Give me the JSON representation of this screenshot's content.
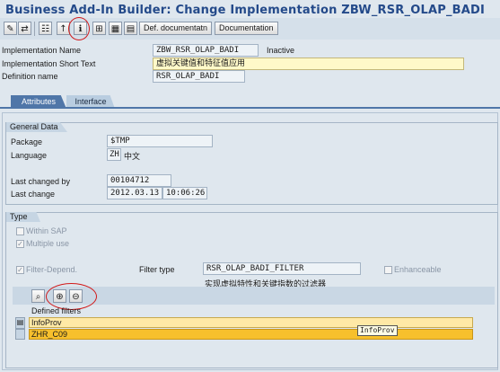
{
  "window": {
    "title": "Business Add-In Builder: Change Implementation ZBW_RSR_OLAP_BADI"
  },
  "toolbar": {
    "icons": [
      "pencil-glasses-icon",
      "where-used-icon",
      "object-list-icon",
      "activate-icon",
      "info-icon",
      "hierarchy-icon",
      "object-directory-icon",
      "documentation-icon"
    ],
    "def_documentation_label": "Def. documentatn",
    "documentation_label": "Documentation"
  },
  "header": {
    "impl_name_label": "Implementation Name",
    "impl_name_value": "ZBW_RSR_OLAP_BADI",
    "impl_status": "Inactive",
    "short_text_label": "Implementation Short Text",
    "short_text_value": "虚拟关键值和特征值应用",
    "def_name_label": "Definition name",
    "def_name_value": "RSR_OLAP_BADI"
  },
  "tabs": [
    {
      "label": "Attributes",
      "active": true
    },
    {
      "label": "Interface",
      "active": false
    }
  ],
  "general_data": {
    "title": "General Data",
    "package_label": "Package",
    "package_value": "$TMP",
    "language_label": "Language",
    "language_code": "ZH",
    "language_name": "中文",
    "last_changed_by_label": "Last changed by",
    "last_changed_by_value": "00104712",
    "last_change_label": "Last change",
    "last_change_date": "2012.03.13",
    "last_change_time": "10:06:26"
  },
  "type_group": {
    "title": "Type",
    "within_sap_label": "Within SAP",
    "within_sap_checked": false,
    "multiple_use_label": "Multiple use",
    "multiple_use_checked": true,
    "filter_depend_label": "Filter-Depend.",
    "filter_depend_checked": true,
    "filter_type_label": "Filter type",
    "filter_type_value": "RSR_OLAP_BADI_FILTER",
    "filter_type_desc": "实现虚拟特性和关键指数的过滤器",
    "enhanceable_label": "Enhanceable",
    "enhanceable_checked": false
  },
  "filters": {
    "icons": [
      "display-icon",
      "insert-row-icon",
      "delete-row-icon"
    ],
    "defined_filters_label": "Defined filters",
    "column_header": "InfoProv",
    "rows": [
      "ZHR_C09"
    ],
    "tooltip": "InfoProv"
  },
  "colors": {
    "title": "#244a8a",
    "tab_active": "#4f76a8",
    "highlight_row": "#f7c02c",
    "header_row": "#ffe9a6",
    "annotation": "#d21a1a"
  }
}
